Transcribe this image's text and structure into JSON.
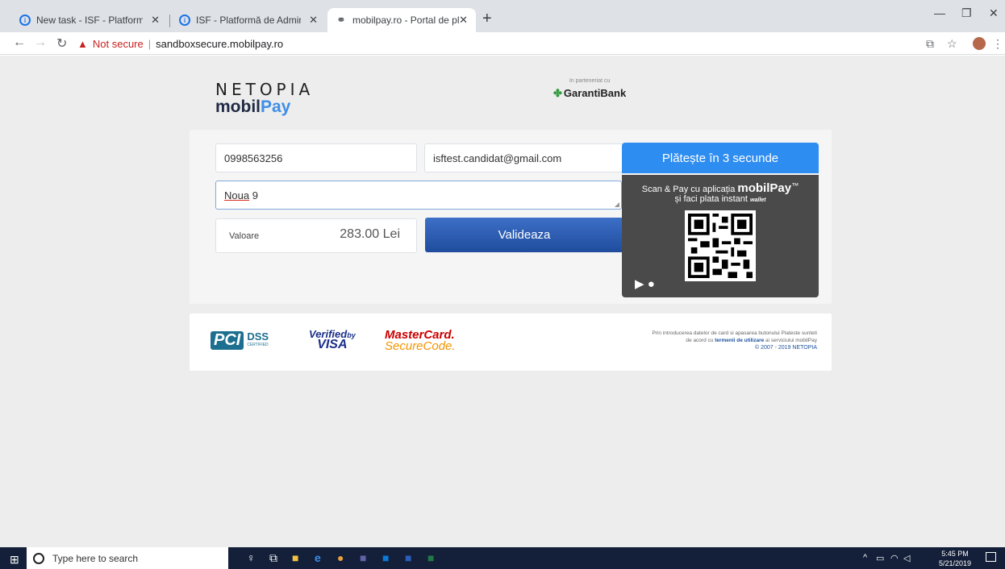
{
  "browser": {
    "tabs": [
      {
        "title": "New task - ISF - Platformă de Ad"
      },
      {
        "title": "ISF - Platformă de Administrare a"
      },
      {
        "title": "mobilpay.ro - Portal de plati"
      }
    ],
    "security_warning": "Not secure",
    "url": "sandboxsecure.mobilpay.ro"
  },
  "page": {
    "logo": {
      "line1": "NETOPIA",
      "line2_a": "mobil",
      "line2_b": "Pay"
    },
    "partner": {
      "label": "In parteneriat cu",
      "bank": "GarantiBank"
    },
    "form": {
      "phone": "0998563256",
      "email": "isftest.candidat@gmail.com",
      "address_word1": "Noua",
      "address_word2": " 9",
      "amount_label": "Valoare",
      "amount_value": "283.00 Lei",
      "validate_label": "Valideaza"
    },
    "fastpay": {
      "header": "Plătește în 3 secunde",
      "line1": "Scan & Pay cu aplicația",
      "brand": "mobilPay",
      "tm": "™",
      "wallet": "wallet",
      "line2": "și faci plata instant"
    },
    "footer": {
      "pci": "PCI",
      "pci_dss": "DSS",
      "pci_certified": "CERTIFIED",
      "verified": "Verified",
      "by": "by",
      "visa": "VISA",
      "mastercard": "MasterCard.",
      "securecode": "SecureCode.",
      "legal_1": "Prin introducerea datelor de card si apasarea butonului Plateste sunteti",
      "legal_2": "de acord cu",
      "legal_terms": "termenii de utilizare",
      "legal_3": "ai serviciului mobilPay",
      "copyright": "© 2007 - 2019 NETOPIA"
    }
  },
  "taskbar": {
    "search_placeholder": "Type here to search",
    "time": "5:45 PM",
    "date": "5/21/2019"
  }
}
